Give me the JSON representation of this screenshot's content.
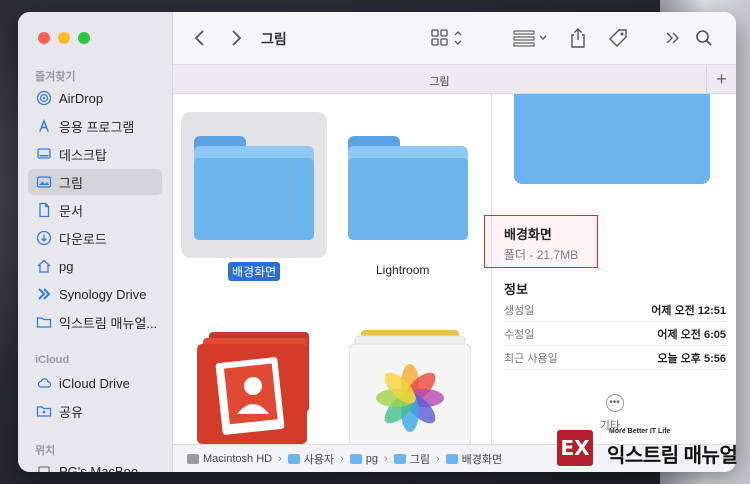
{
  "window": {
    "title": "그림"
  },
  "sidebar": {
    "favorites_title": "즐겨찾기",
    "favorites": [
      {
        "label": "AirDrop",
        "icon": "airdrop-icon"
      },
      {
        "label": "응용 프로그램",
        "icon": "applications-icon"
      },
      {
        "label": "데스크탑",
        "icon": "desktop-icon"
      },
      {
        "label": "그림",
        "icon": "pictures-icon",
        "selected": true
      },
      {
        "label": "문서",
        "icon": "document-icon"
      },
      {
        "label": "다운로드",
        "icon": "download-icon"
      },
      {
        "label": "pg",
        "icon": "home-icon"
      },
      {
        "label": "Synology Drive",
        "icon": "synology-icon"
      },
      {
        "label": "익스트림 매뉴얼...",
        "icon": "folder-icon"
      }
    ],
    "icloud_title": "iCloud",
    "icloud": [
      {
        "label": "iCloud Drive",
        "icon": "cloud-icon"
      },
      {
        "label": "공유",
        "icon": "shared-folder-icon"
      }
    ],
    "locations_title": "위치",
    "locations": [
      {
        "label": "PG's MacBoo...",
        "icon": "laptop-icon"
      }
    ]
  },
  "toolbar": {
    "title": "그림"
  },
  "tabbar": {
    "label": "그림",
    "add_label": "+"
  },
  "items": [
    {
      "label": "배경화면",
      "kind": "folder",
      "selected": true
    },
    {
      "label": "Lightroom",
      "kind": "folder"
    },
    {
      "label": "",
      "kind": "photo-booth-app"
    },
    {
      "label": "",
      "kind": "photos-library"
    }
  ],
  "pathbar": [
    {
      "label": "Macintosh HD",
      "icon": "disk-icon"
    },
    {
      "label": "사용자",
      "icon": "folder-icon"
    },
    {
      "label": "pg",
      "icon": "folder-icon"
    },
    {
      "label": "그림",
      "icon": "folder-icon"
    },
    {
      "label": "배경화면",
      "icon": "folder-icon"
    }
  ],
  "preview": {
    "name": "배경화면",
    "subtitle": "폴더 - 21.7MB",
    "info_title": "정보",
    "rows": [
      {
        "key": "생성일",
        "value": "어제 오전 12:51"
      },
      {
        "key": "수정일",
        "value": "어제 오전 6:05"
      },
      {
        "key": "최근 사용일",
        "value": "오늘 오후 5:56"
      }
    ],
    "more_label": "기타..."
  },
  "watermark": {
    "tagline": "More Better IT Life",
    "brand": "익스트림 매뉴얼"
  },
  "colors": {
    "accent": "#2a6fd6",
    "folder": "#6cb4ee",
    "highlight_border": "#e02a3c",
    "watermark_red": "#b21f2d"
  }
}
